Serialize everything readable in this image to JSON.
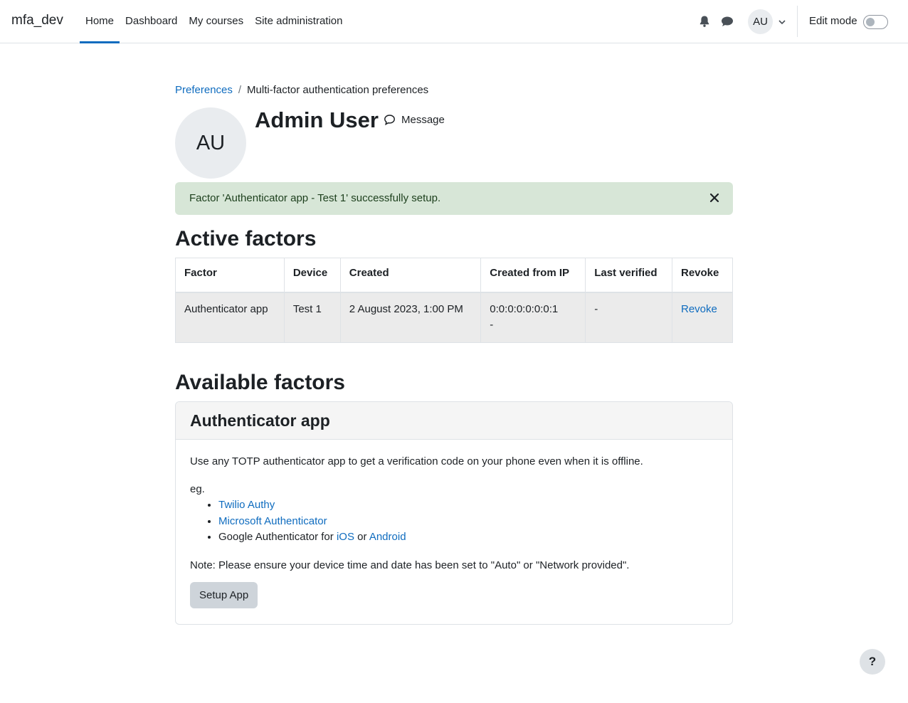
{
  "navbar": {
    "brand": "mfa_dev",
    "links": [
      {
        "label": "Home",
        "active": true
      },
      {
        "label": "Dashboard"
      },
      {
        "label": "My courses"
      },
      {
        "label": "Site administration"
      }
    ],
    "avatar_initials": "AU",
    "edit_mode_label": "Edit mode",
    "edit_mode_on": false,
    "icons": [
      "bell-icon",
      "chat-icon",
      "chevron-down-icon"
    ]
  },
  "breadcrumb": {
    "parent": "Preferences",
    "separator": "/",
    "current": "Multi-factor authentication preferences"
  },
  "profile": {
    "initials": "AU",
    "name": "Admin User",
    "message_label": "Message"
  },
  "alert": {
    "text": "Factor 'Authenticator app - Test 1' successfully setup.",
    "close_symbol": "✕"
  },
  "active_factors": {
    "title": "Active factors",
    "columns": [
      "Factor",
      "Device",
      "Created",
      "Created from IP",
      "Last verified",
      "Revoke"
    ],
    "rows": [
      {
        "factor": "Authenticator app",
        "device": "Test 1",
        "created": "2 August 2023, 1:00 PM",
        "ip_line1": "0:0:0:0:0:0:0:1",
        "ip_line2": "-",
        "last_verified": "-",
        "revoke": "Revoke"
      }
    ]
  },
  "available_factors": {
    "title": "Available factors",
    "card": {
      "header": "Authenticator app",
      "description": "Use any TOTP authenticator app to get a verification code on your phone even when it is offline.",
      "eg": "eg.",
      "apps": {
        "twilio": "Twilio Authy",
        "microsoft": "Microsoft Authenticator",
        "google_prefix": "Google Authenticator for",
        "ios": "iOS",
        "or": "or",
        "android": "Android"
      },
      "note": "Note: Please ensure your device time and date has been set to \"Auto\" or \"Network provided\".",
      "button": "Setup App"
    }
  },
  "help_button": "?",
  "colors": {
    "link": "#0f6cbf",
    "alert_bg": "#d7e6d7",
    "row_bg": "#ebebeb",
    "button_bg": "#ced4da"
  }
}
